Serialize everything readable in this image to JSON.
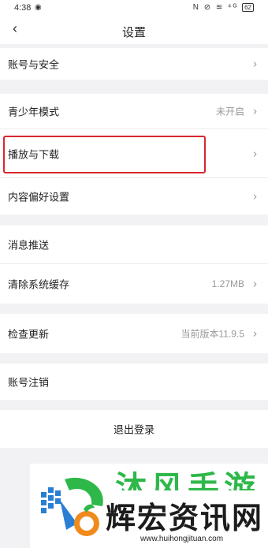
{
  "status_bar": {
    "time": "4:38",
    "right_icons": "N ⊘ ≋ ⁴ᴳ",
    "battery": "62"
  },
  "nav": {
    "back_glyph": "‹",
    "title": "设置"
  },
  "settings": [
    {
      "label": "账号与安全",
      "value": "",
      "chevron": "›"
    },
    {
      "label": "青少年模式",
      "value": "未开启",
      "chevron": "›"
    },
    {
      "label": "播放与下载",
      "value": "",
      "chevron": "›"
    },
    {
      "label": "内容偏好设置",
      "value": "",
      "chevron": "›"
    },
    {
      "label": "消息推送",
      "value": "",
      "chevron": ""
    },
    {
      "label": "清除系统缓存",
      "value": "1.27MB",
      "chevron": "›"
    },
    {
      "label": "检查更新",
      "value": "当前版本11.9.5",
      "chevron": "›"
    },
    {
      "label": "账号注销",
      "value": "",
      "chevron": ""
    }
  ],
  "logout_label": "退出登录",
  "watermark": {
    "title_top": "沐风手游",
    "title": "辉宏资讯网",
    "url": "www.huihongjituan.com"
  },
  "colors": {
    "highlight_border": "#d8262e",
    "watermark_green": "#2eb84a",
    "watermark_blue": "#2a7fd4"
  }
}
